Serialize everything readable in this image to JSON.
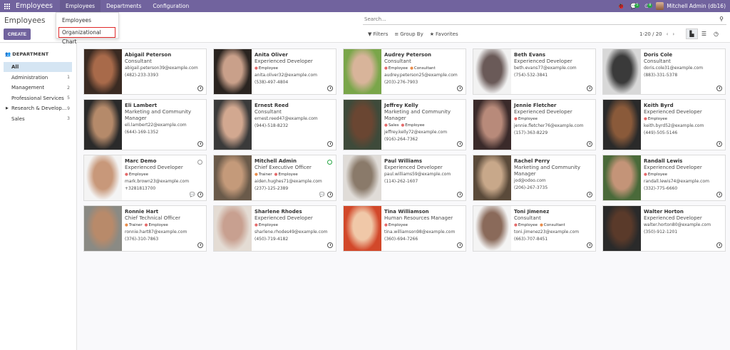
{
  "navbar": {
    "app_title": "Employees",
    "menu": [
      "Employees",
      "Departments",
      "Configuration"
    ],
    "chat_badge": "5",
    "activity_badge": "8",
    "user": "Mitchell Admin (db16)"
  },
  "dropdown": {
    "items": [
      "Employees",
      "Organizational Chart"
    ]
  },
  "control_panel": {
    "title": "Employees",
    "create_label": "CREATE",
    "search_placeholder": "Search...",
    "filters_label": "Filters",
    "group_by_label": "Group By",
    "favorites_label": "Favorites",
    "pager": "1-20 / 20"
  },
  "sidebar": {
    "heading": "DEPARTMENT",
    "items": [
      {
        "label": "All",
        "count": ""
      },
      {
        "label": "Administration",
        "count": "1"
      },
      {
        "label": "Management",
        "count": "2"
      },
      {
        "label": "Professional Services",
        "count": "5"
      },
      {
        "label": "Research & Develop...",
        "count": "9"
      },
      {
        "label": "Sales",
        "count": "3"
      }
    ]
  },
  "employees": [
    {
      "name": "Abigail Peterson",
      "job": "Consultant",
      "tags": [],
      "email": "abigail.peterson39@example.com",
      "phone": "(482)-233-3393",
      "photo": [
        "#3a2a22",
        "#a86a4a"
      ]
    },
    {
      "name": "Anita Oliver",
      "job": "Experienced Developer",
      "tags": [
        "Employee"
      ],
      "email": "anita.oliver32@example.com",
      "phone": "(538)-497-4804",
      "photo": [
        "#2a2420",
        "#c9a08a"
      ]
    },
    {
      "name": "Audrey Peterson",
      "job": "Consultant",
      "tags": [
        "Employee",
        "Consultant"
      ],
      "email": "audrey.peterson25@example.com",
      "phone": "(203)-276-7903",
      "photo": [
        "#7aa64a",
        "#d8b49a"
      ]
    },
    {
      "name": "Beth Evans",
      "job": "Experienced Developer",
      "tags": [],
      "email": "beth.evans77@example.com",
      "phone": "(754)-532-3841",
      "photo": [
        "#f2f2f2",
        "#6a5a58"
      ]
    },
    {
      "name": "Doris Cole",
      "job": "Consultant",
      "tags": [],
      "email": "doris.cole31@example.com",
      "phone": "(883)-331-5378",
      "photo": [
        "#d8d8d8",
        "#3a3a3a"
      ]
    },
    {
      "name": "Eli Lambert",
      "job": "Marketing and Community Manager",
      "tags": [],
      "email": "eli.lambert22@example.com",
      "phone": "(644)-169-1352",
      "photo": [
        "#2a2a2a",
        "#b58a6a"
      ]
    },
    {
      "name": "Ernest Reed",
      "job": "Consultant",
      "tags": [],
      "email": "ernest.reed47@example.com",
      "phone": "(944)-518-8232",
      "photo": [
        "#3a3a3a",
        "#d2a890"
      ]
    },
    {
      "name": "Jeffrey Kelly",
      "job": "Marketing and Community Manager",
      "tags": [
        "Sales",
        "Employee"
      ],
      "email": "jeffrey.kelly72@example.com",
      "phone": "(916)-264-7362",
      "photo": [
        "#3e4a3a",
        "#6a4632"
      ]
    },
    {
      "name": "Jennie Fletcher",
      "job": "Experienced Developer",
      "tags": [
        "Employee"
      ],
      "email": "jennie.fletcher76@example.com",
      "phone": "(157)-363-8229",
      "photo": [
        "#3a2a2a",
        "#b88a7a"
      ]
    },
    {
      "name": "Keith Byrd",
      "job": "Experienced Developer",
      "tags": [
        "Employee"
      ],
      "email": "keith.byrd52@example.com",
      "phone": "(449)-505-5146",
      "photo": [
        "#2a2a2a",
        "#8a5a3a"
      ]
    },
    {
      "name": "Marc Demo",
      "job": "Experienced Developer",
      "tags": [
        "Employee"
      ],
      "email": "mark.brown23@example.com",
      "phone": "+3281813700",
      "photo": [
        "#f4f4f4",
        "#c8987a"
      ],
      "status": "away",
      "chat": true
    },
    {
      "name": "Mitchell Admin",
      "job": "Chief Executive Officer",
      "tags": [
        "Trainer",
        "Employee"
      ],
      "email": "aiden.hughes71@example.com",
      "phone": "(237)-125-2389",
      "photo": [
        "#6a5a4a",
        "#c49a7a"
      ],
      "status": "online",
      "chat": true
    },
    {
      "name": "Paul Williams",
      "job": "Experienced Developer",
      "tags": [],
      "email": "paul.williams59@example.com",
      "phone": "(114)-262-1607",
      "photo": [
        "#e0dcd8",
        "#8a7a6a"
      ]
    },
    {
      "name": "Rachel Perry",
      "job": "Marketing and Community Manager",
      "tags": [],
      "email": "jod@odoo.com",
      "phone": "(206)-267-3735",
      "photo": [
        "#5a4a3a",
        "#c8a88a"
      ]
    },
    {
      "name": "Randall Lewis",
      "job": "Experienced Developer",
      "tags": [
        "Employee"
      ],
      "email": "randall.lewis74@example.com",
      "phone": "(332)-775-6660",
      "photo": [
        "#4a6a3a",
        "#c49478"
      ]
    },
    {
      "name": "Ronnie Hart",
      "job": "Chief Technical Officer",
      "tags": [
        "Trainer",
        "Employee"
      ],
      "email": "ronnie.hart87@example.com",
      "phone": "(376)-310-7863",
      "photo": [
        "#8a8a84",
        "#b88a6a"
      ]
    },
    {
      "name": "Sharlene Rhodes",
      "job": "Experienced Developer",
      "tags": [
        "Employee"
      ],
      "email": "sharlene.rhodes49@example.com",
      "phone": "(450)-719-4182",
      "photo": [
        "#e4dcd4",
        "#c8a090"
      ]
    },
    {
      "name": "Tina Williamson",
      "job": "Human Resources Manager",
      "tags": [
        "Employee"
      ],
      "email": "tina.williamson98@example.com",
      "phone": "(360)-694-7266",
      "photo": [
        "#d2482a",
        "#f0c8a8"
      ]
    },
    {
      "name": "Toni Jimenez",
      "job": "Consultant",
      "tags": [
        "Employee",
        "Consultant"
      ],
      "email": "toni.jimenez23@example.com",
      "phone": "(663)-707-8451",
      "photo": [
        "#f4f4f4",
        "#8a6a5a"
      ]
    },
    {
      "name": "Walter Horton",
      "job": "Experienced Developer",
      "tags": [],
      "email": "walter.horton80@example.com",
      "phone": "(350)-912-1201",
      "photo": [
        "#2a2a2a",
        "#5a3a2a"
      ]
    }
  ]
}
